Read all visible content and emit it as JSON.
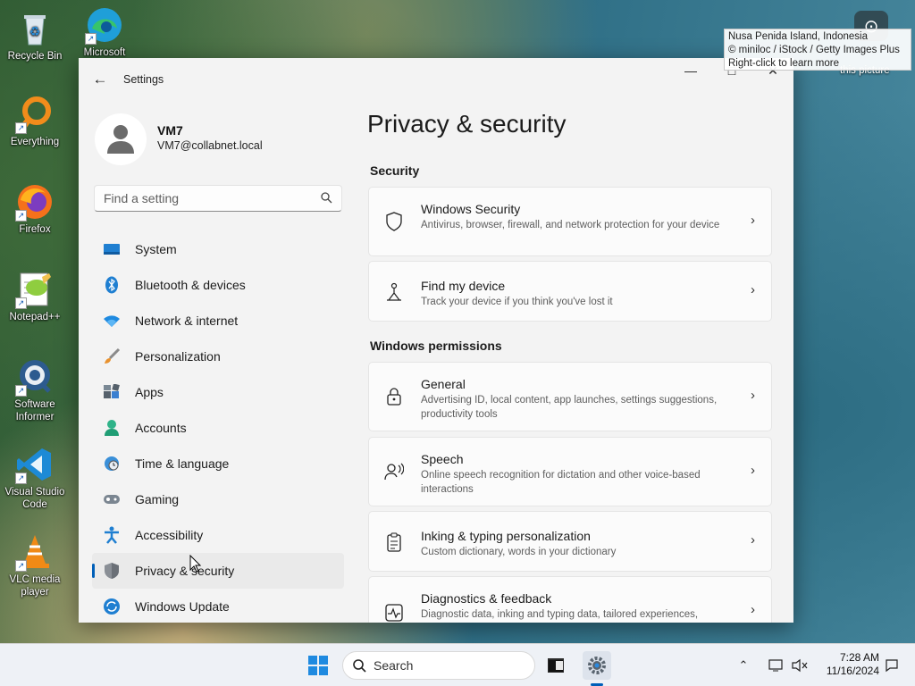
{
  "desktop": {
    "icons": [
      {
        "label": "Recycle Bin",
        "icon": "recycle-bin-icon"
      },
      {
        "label": "Microsoft",
        "icon": "edge-icon"
      },
      {
        "label": "Everything",
        "icon": "everything-search-icon"
      },
      {
        "label": "Firefox",
        "icon": "firefox-icon"
      },
      {
        "label": "Notepad++",
        "icon": "notepad-plus-plus-icon"
      },
      {
        "label": "Software Informer",
        "icon": "software-informer-icon"
      },
      {
        "label": "Visual Studio Code",
        "icon": "vscode-icon"
      },
      {
        "label": "VLC media player",
        "icon": "vlc-icon"
      }
    ],
    "wallpaper_credit": {
      "line1": "Nusa Penida Island, Indonesia",
      "line2": "© miniloc / iStock / Getty Images Plus",
      "line3": "Right-click to learn more"
    },
    "learn_more_label": "this picture"
  },
  "window": {
    "title": "Settings",
    "controls": {
      "minimize": "—",
      "maximize": "□",
      "close": "✕"
    }
  },
  "account": {
    "name": "VM7",
    "email": "VM7@collabnet.local"
  },
  "search": {
    "placeholder": "Find a setting"
  },
  "nav": {
    "items": [
      {
        "label": "System",
        "icon": "system-icon"
      },
      {
        "label": "Bluetooth & devices",
        "icon": "bluetooth-icon"
      },
      {
        "label": "Network & internet",
        "icon": "wifi-icon"
      },
      {
        "label": "Personalization",
        "icon": "brush-icon"
      },
      {
        "label": "Apps",
        "icon": "apps-icon"
      },
      {
        "label": "Accounts",
        "icon": "accounts-icon"
      },
      {
        "label": "Time & language",
        "icon": "clock-globe-icon"
      },
      {
        "label": "Gaming",
        "icon": "gamepad-icon"
      },
      {
        "label": "Accessibility",
        "icon": "accessibility-icon"
      },
      {
        "label": "Privacy & security",
        "icon": "shield-icon",
        "active": true
      },
      {
        "label": "Windows Update",
        "icon": "windows-update-icon"
      }
    ]
  },
  "main": {
    "title": "Privacy & security",
    "sections": [
      {
        "heading": "Security",
        "cards": [
          {
            "title": "Windows Security",
            "desc": "Antivirus, browser, firewall, and network protection for your device",
            "icon": "shield-outline-icon"
          },
          {
            "title": "Find my device",
            "desc": "Track your device if you think you've lost it",
            "icon": "find-device-icon"
          }
        ]
      },
      {
        "heading": "Windows permissions",
        "cards": [
          {
            "title": "General",
            "desc": "Advertising ID, local content, app launches, settings suggestions, productivity tools",
            "icon": "lock-icon"
          },
          {
            "title": "Speech",
            "desc": "Online speech recognition for dictation and other voice-based interactions",
            "icon": "speech-icon"
          },
          {
            "title": "Inking & typing personalization",
            "desc": "Custom dictionary, words in your dictionary",
            "icon": "clipboard-icon"
          },
          {
            "title": "Diagnostics & feedback",
            "desc": "Diagnostic data, inking and typing data, tailored experiences,",
            "icon": "diagnostics-icon"
          }
        ]
      }
    ]
  },
  "taskbar": {
    "search_label": "Search",
    "time": "7:28 AM",
    "date": "11/16/2024"
  },
  "colors": {
    "accent": "#005fb8",
    "window_bg": "#f3f3f3",
    "card_bg": "#fbfbfb"
  }
}
